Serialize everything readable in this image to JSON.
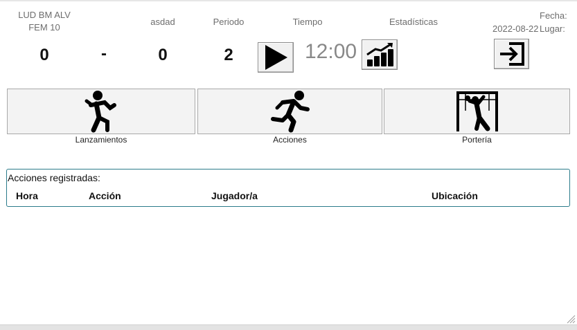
{
  "header": {
    "team": "LUD BM ALV",
    "category": "FEM 10",
    "opponent": "asdad",
    "period_label": "Periodo",
    "time_label": "Tiempo",
    "stats_label": "Estadísticas",
    "date_label": "Fecha:",
    "date_value": "2022-08-22",
    "place_label": "Lugar:"
  },
  "score": {
    "home": "0",
    "separator": "-",
    "away": "0",
    "period": "2",
    "time": "12:00"
  },
  "icons": {
    "play": "play-icon",
    "stats": "bar-chart-growth-icon",
    "exit": "exit-icon"
  },
  "actions": [
    {
      "label": "Lanzamientos",
      "icon": "throwing-player-icon"
    },
    {
      "label": "Acciones",
      "icon": "running-player-icon"
    },
    {
      "label": "Portería",
      "icon": "goalkeeper-icon"
    }
  ],
  "log": {
    "title": "Acciones registradas:",
    "columns": [
      "Hora",
      "Acción",
      "Jugador/a",
      "Ubicación"
    ]
  }
}
